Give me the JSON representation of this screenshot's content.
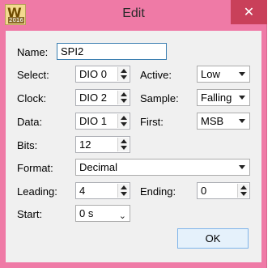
{
  "window": {
    "title": "Edit",
    "icon_letter": "W",
    "icon_year": "2016",
    "close_glyph": "✕"
  },
  "form": {
    "name_label": "Name:",
    "name_value": "SPI2",
    "select_label": "Select:",
    "select_value": "DIO 0",
    "active_label": "Active:",
    "active_value": "Low",
    "clock_label": "Clock:",
    "clock_value": "DIO 2",
    "sample_label": "Sample:",
    "sample_value": "Falling",
    "data_label": "Data:",
    "data_value": "DIO 1",
    "first_label": "First:",
    "first_value": "MSB",
    "bits_label": "Bits:",
    "bits_value": "12",
    "format_label": "Format:",
    "format_value": "Decimal",
    "leading_label": "Leading:",
    "leading_value": "4",
    "ending_label": "Ending:",
    "ending_value": "0",
    "start_label": "Start:",
    "start_value": "0 s"
  },
  "buttons": {
    "ok": "OK"
  },
  "colors": {
    "titlebar": "#ef7aa6",
    "close": "#c9405a",
    "client": "#f0f0f0",
    "focus_border": "#3c7fb1"
  }
}
